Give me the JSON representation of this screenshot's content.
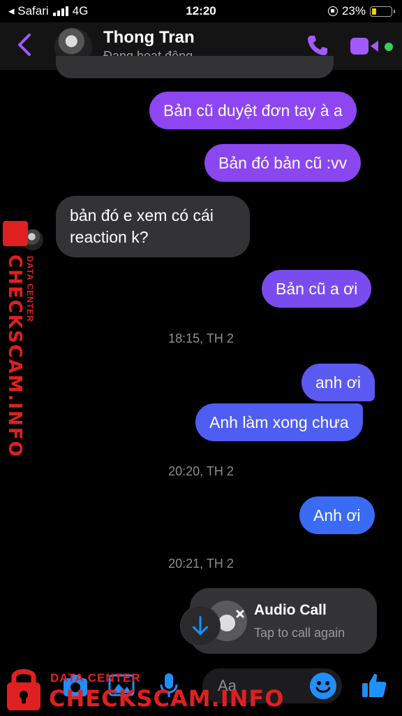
{
  "status_bar": {
    "carrier": "Safari",
    "network": "4G",
    "time": "12:20",
    "battery_percent": "23%",
    "battery_level": 0.23
  },
  "header": {
    "contact_name": "Thong Tran",
    "status": "Đang hoạt động",
    "accent_color": "#a259ff",
    "online_color": "#31d15a"
  },
  "messages": [
    {
      "from": "me",
      "text": "Bản cũ duyệt đơn tay à a"
    },
    {
      "from": "me",
      "text": "Bản đó bản cũ :vv"
    },
    {
      "from": "them",
      "text_line1": "bản đó e xem có cái",
      "text_line2": "reaction k?"
    },
    {
      "from": "me",
      "text": "Bản cũ a ơi"
    },
    {
      "timestamp": "18:15, TH 2"
    },
    {
      "from": "me",
      "text": "anh ơi"
    },
    {
      "from": "me",
      "text": "Anh làm xong chưa"
    },
    {
      "timestamp": "20:20, TH 2"
    },
    {
      "from": "me",
      "text": "Anh ơi"
    },
    {
      "timestamp": "20:21, TH 2"
    }
  ],
  "call_card": {
    "title": "Audio Call",
    "subtitle": "Tap to call again"
  },
  "composer": {
    "placeholder": "Aa"
  },
  "watermark": {
    "brand": "CHECKSCAM.INFO",
    "tag": "DATA CENTER",
    "color": "#e02020"
  },
  "icons": [
    "back-chevron-icon",
    "phone-icon",
    "video-camera-icon",
    "camera-icon",
    "image-icon",
    "microphone-icon",
    "emoji-icon",
    "thumbs-up-icon",
    "arrow-down-icon",
    "phone-missed-icon"
  ]
}
